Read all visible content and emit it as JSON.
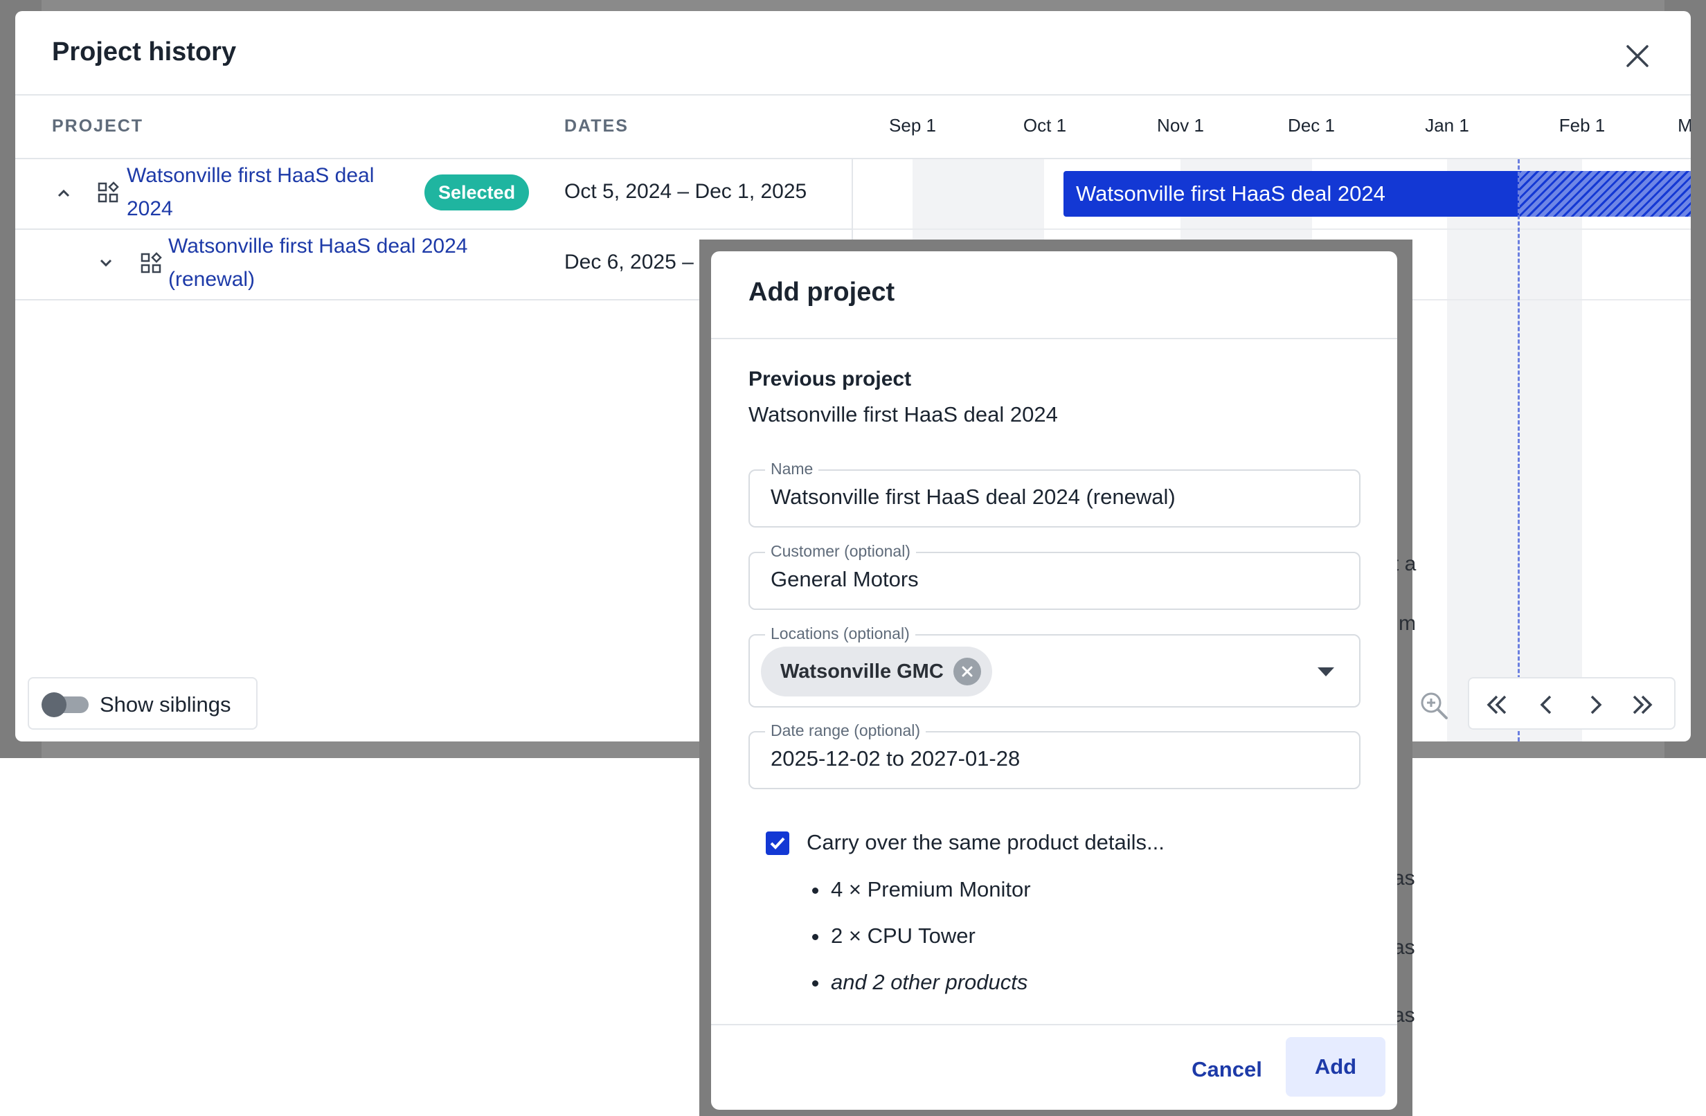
{
  "project_history": {
    "title": "Project history",
    "columns": {
      "project": "PROJECT",
      "dates": "DATES"
    },
    "months": [
      "Sep 1",
      "Oct 1",
      "Nov 1",
      "Dec 1",
      "Jan 1",
      "Feb 1",
      "M"
    ],
    "rows": [
      {
        "name_line1": "Watsonville first HaaS deal",
        "name_line2": "2024",
        "badge": "Selected",
        "dates": "Oct 5, 2024 – Dec 1, 2025",
        "expanded": true
      },
      {
        "name_line1": "Watsonville first HaaS deal 2024",
        "name_line2": "(renewal)",
        "dates": "Dec 6, 2025 –",
        "expanded": false
      }
    ],
    "gantt_bar_label": "Watsonville first HaaS deal 2024",
    "show_siblings_label": "Show siblings",
    "show_siblings_on": false
  },
  "add_project": {
    "title": "Add project",
    "previous_project_label": "Previous project",
    "previous_project_value": "Watsonville first HaaS deal 2024",
    "name_label": "Name",
    "name_value": "Watsonville first HaaS deal 2024 (renewal)",
    "customer_label": "Customer (optional)",
    "customer_value": "General Motors",
    "locations_label": "Locations (optional)",
    "locations_chip": "Watsonville GMC",
    "date_range_label": "Date range (optional)",
    "date_range_value": "2025-12-02 to 2027-01-28",
    "carry_over_label": "Carry over the same product details...",
    "carry_over_checked": true,
    "products": [
      "4 × Premium Monitor",
      "2 × CPU Tower"
    ],
    "products_more": "and 2 other products",
    "cancel_label": "Cancel",
    "add_label": "Add"
  },
  "background_peek": {
    "t1": "t a",
    "t2": "m",
    "t3": "as",
    "t4": "as",
    "t5": "as"
  },
  "colors": {
    "primary": "#1338d4",
    "link": "#1d3aa8",
    "selected_badge": "#1fb5a0",
    "overlay": "#7d7d7d"
  }
}
